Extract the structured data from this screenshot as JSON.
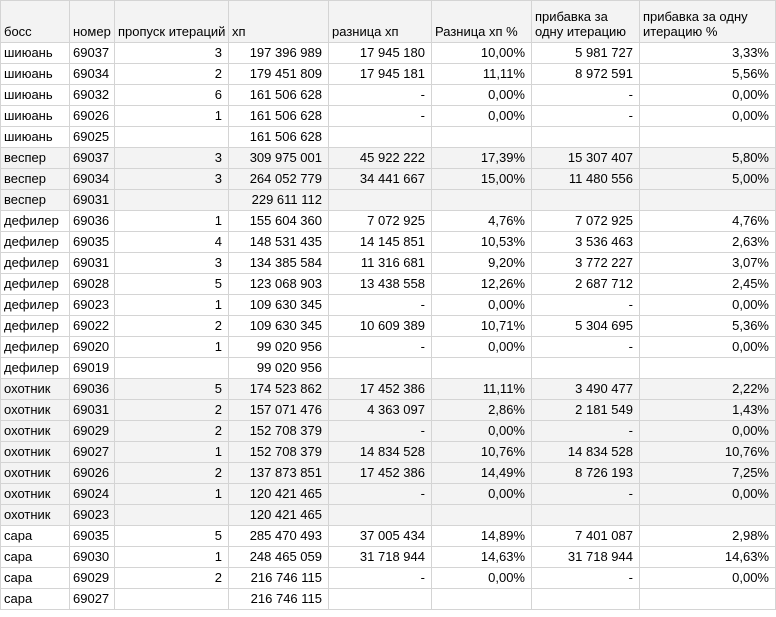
{
  "headers": [
    "босс",
    "номер",
    "пропуск итераций",
    "хп",
    "разница хп",
    "Разница хп %",
    "прибавка за одну итерацию",
    "прибавка за одну итерацию %"
  ],
  "rows": [
    {
      "boss": "шиюань",
      "num": "69037",
      "skip": "3",
      "hp": "197 396 989",
      "diff": "17 945 180",
      "diff_pct": "10,00%",
      "per_iter": "5 981 727",
      "per_iter_pct": "3,33%",
      "shade": false
    },
    {
      "boss": "шиюань",
      "num": "69034",
      "skip": "2",
      "hp": "179 451 809",
      "diff": "17 945 181",
      "diff_pct": "11,11%",
      "per_iter": "8 972 591",
      "per_iter_pct": "5,56%",
      "shade": false
    },
    {
      "boss": "шиюань",
      "num": "69032",
      "skip": "6",
      "hp": "161 506 628",
      "diff": "-",
      "diff_pct": "0,00%",
      "per_iter": "-",
      "per_iter_pct": "0,00%",
      "shade": false
    },
    {
      "boss": "шиюань",
      "num": "69026",
      "skip": "1",
      "hp": "161 506 628",
      "diff": "-",
      "diff_pct": "0,00%",
      "per_iter": "-",
      "per_iter_pct": "0,00%",
      "shade": false
    },
    {
      "boss": "шиюань",
      "num": "69025",
      "skip": "",
      "hp": "161 506 628",
      "diff": "",
      "diff_pct": "",
      "per_iter": "",
      "per_iter_pct": "",
      "shade": false
    },
    {
      "boss": "веспер",
      "num": "69037",
      "skip": "3",
      "hp": "309 975 001",
      "diff": "45 922 222",
      "diff_pct": "17,39%",
      "per_iter": "15 307 407",
      "per_iter_pct": "5,80%",
      "shade": true
    },
    {
      "boss": "веспер",
      "num": "69034",
      "skip": "3",
      "hp": "264 052 779",
      "diff": "34 441 667",
      "diff_pct": "15,00%",
      "per_iter": "11 480 556",
      "per_iter_pct": "5,00%",
      "shade": true
    },
    {
      "boss": "веспер",
      "num": "69031",
      "skip": "",
      "hp": "229 611 112",
      "diff": "",
      "diff_pct": "",
      "per_iter": "",
      "per_iter_pct": "",
      "shade": true
    },
    {
      "boss": "дефилер",
      "num": "69036",
      "skip": "1",
      "hp": "155 604 360",
      "diff": "7 072 925",
      "diff_pct": "4,76%",
      "per_iter": "7 072 925",
      "per_iter_pct": "4,76%",
      "shade": false
    },
    {
      "boss": "дефилер",
      "num": "69035",
      "skip": "4",
      "hp": "148 531 435",
      "diff": "14 145 851",
      "diff_pct": "10,53%",
      "per_iter": "3 536 463",
      "per_iter_pct": "2,63%",
      "shade": false
    },
    {
      "boss": "дефилер",
      "num": "69031",
      "skip": "3",
      "hp": "134 385 584",
      "diff": "11 316 681",
      "diff_pct": "9,20%",
      "per_iter": "3 772 227",
      "per_iter_pct": "3,07%",
      "shade": false
    },
    {
      "boss": "дефилер",
      "num": "69028",
      "skip": "5",
      "hp": "123 068 903",
      "diff": "13 438 558",
      "diff_pct": "12,26%",
      "per_iter": "2 687 712",
      "per_iter_pct": "2,45%",
      "shade": false
    },
    {
      "boss": "дефилер",
      "num": "69023",
      "skip": "1",
      "hp": "109 630 345",
      "diff": "-",
      "diff_pct": "0,00%",
      "per_iter": "-",
      "per_iter_pct": "0,00%",
      "shade": false
    },
    {
      "boss": "дефилер",
      "num": "69022",
      "skip": "2",
      "hp": "109 630 345",
      "diff": "10 609 389",
      "diff_pct": "10,71%",
      "per_iter": "5 304 695",
      "per_iter_pct": "5,36%",
      "shade": false
    },
    {
      "boss": "дефилер",
      "num": "69020",
      "skip": "1",
      "hp": "99 020 956",
      "diff": "-",
      "diff_pct": "0,00%",
      "per_iter": "-",
      "per_iter_pct": "0,00%",
      "shade": false
    },
    {
      "boss": "дефилер",
      "num": "69019",
      "skip": "",
      "hp": "99 020 956",
      "diff": "",
      "diff_pct": "",
      "per_iter": "",
      "per_iter_pct": "",
      "shade": false
    },
    {
      "boss": "охотник",
      "num": "69036",
      "skip": "5",
      "hp": "174 523 862",
      "diff": "17 452 386",
      "diff_pct": "11,11%",
      "per_iter": "3 490 477",
      "per_iter_pct": "2,22%",
      "shade": true
    },
    {
      "boss": "охотник",
      "num": "69031",
      "skip": "2",
      "hp": "157 071 476",
      "diff": "4 363 097",
      "diff_pct": "2,86%",
      "per_iter": "2 181 549",
      "per_iter_pct": "1,43%",
      "shade": true
    },
    {
      "boss": "охотник",
      "num": "69029",
      "skip": "2",
      "hp": "152 708 379",
      "diff": "-",
      "diff_pct": "0,00%",
      "per_iter": "-",
      "per_iter_pct": "0,00%",
      "shade": true
    },
    {
      "boss": "охотник",
      "num": "69027",
      "skip": "1",
      "hp": "152 708 379",
      "diff": "14 834 528",
      "diff_pct": "10,76%",
      "per_iter": "14 834 528",
      "per_iter_pct": "10,76%",
      "shade": true
    },
    {
      "boss": "охотник",
      "num": "69026",
      "skip": "2",
      "hp": "137 873 851",
      "diff": "17 452 386",
      "diff_pct": "14,49%",
      "per_iter": "8 726 193",
      "per_iter_pct": "7,25%",
      "shade": true
    },
    {
      "boss": "охотник",
      "num": "69024",
      "skip": "1",
      "hp": "120 421 465",
      "diff": "-",
      "diff_pct": "0,00%",
      "per_iter": "-",
      "per_iter_pct": "0,00%",
      "shade": true
    },
    {
      "boss": "охотник",
      "num": "69023",
      "skip": "",
      "hp": "120 421 465",
      "diff": "",
      "diff_pct": "",
      "per_iter": "",
      "per_iter_pct": "",
      "shade": true
    },
    {
      "boss": "сара",
      "num": "69035",
      "skip": "5",
      "hp": "285 470 493",
      "diff": "37 005 434",
      "diff_pct": "14,89%",
      "per_iter": "7 401 087",
      "per_iter_pct": "2,98%",
      "shade": false
    },
    {
      "boss": "сара",
      "num": "69030",
      "skip": "1",
      "hp": "248 465 059",
      "diff": "31 718 944",
      "diff_pct": "14,63%",
      "per_iter": "31 718 944",
      "per_iter_pct": "14,63%",
      "shade": false
    },
    {
      "boss": "сара",
      "num": "69029",
      "skip": "2",
      "hp": "216 746 115",
      "diff": "-",
      "diff_pct": "0,00%",
      "per_iter": "-",
      "per_iter_pct": "0,00%",
      "shade": false
    },
    {
      "boss": "сара",
      "num": "69027",
      "skip": "",
      "hp": "216 746 115",
      "diff": "",
      "diff_pct": "",
      "per_iter": "",
      "per_iter_pct": "",
      "shade": false
    }
  ]
}
